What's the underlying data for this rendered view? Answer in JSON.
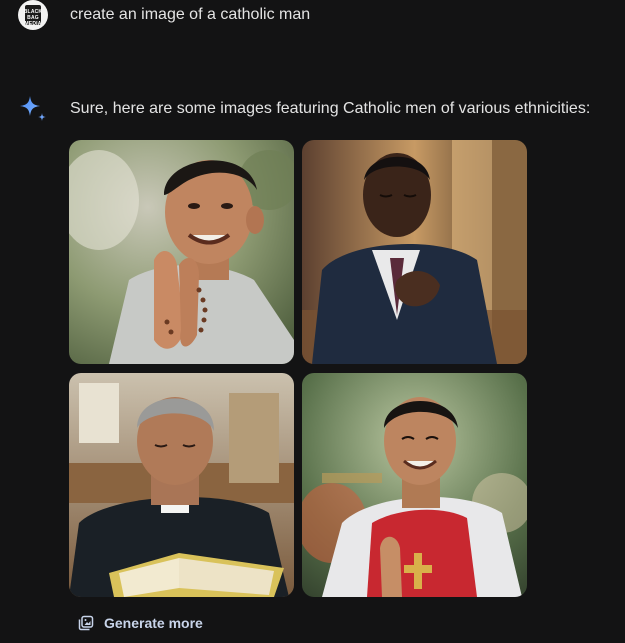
{
  "user": {
    "avatar_text": "BLACK BAG MEDIA",
    "prompt": "create an image of a catholic man"
  },
  "response": {
    "icon": "sparkle-icon",
    "text": "Sure, here are some images featuring Catholic men of various ethnicities:",
    "images": [
      {
        "subject": "smiling man with rosary, hands clasped"
      },
      {
        "subject": "man in dark suit praying in church"
      },
      {
        "subject": "gray-haired priest reading bible"
      },
      {
        "subject": "smiling young man in red vestment praying"
      }
    ]
  },
  "actions": {
    "generate_more_icon": "image-stack-icon",
    "generate_more_label": "Generate more"
  },
  "colors": {
    "background": "#131314",
    "text": "#e3e3e3",
    "accent": "#c8d4ea",
    "spark_blue": "#4b8cf5"
  }
}
